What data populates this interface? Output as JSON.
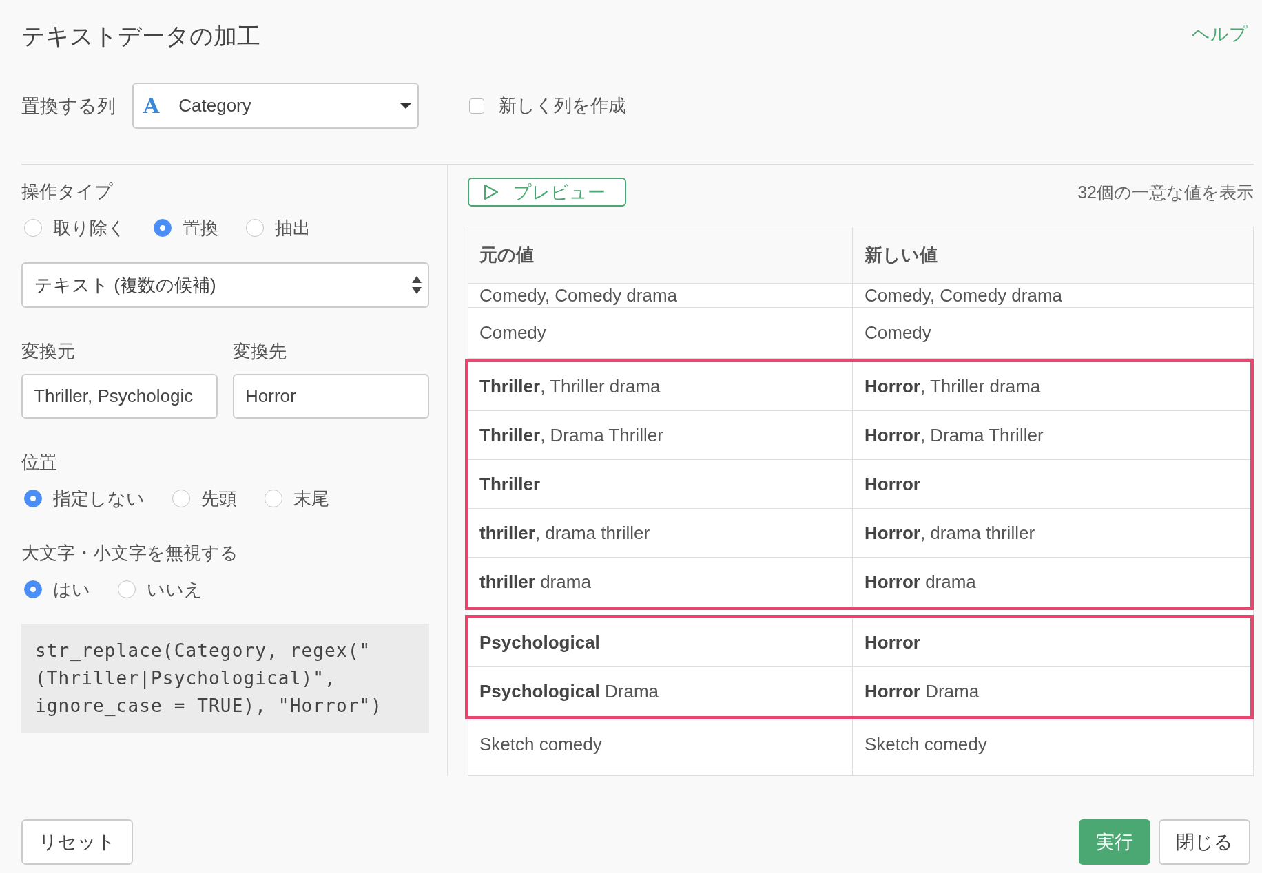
{
  "title": "テキストデータの加工",
  "help_link": "ヘルプ",
  "target_column": {
    "label": "置換する列",
    "type_glyph": "A",
    "value": "Category"
  },
  "new_column": {
    "label": "新しく列を作成",
    "checked": false
  },
  "operation_type": {
    "label": "操作タイプ",
    "options": [
      {
        "label": "取り除く",
        "selected": false
      },
      {
        "label": "置換",
        "selected": true
      },
      {
        "label": "抽出",
        "selected": false
      }
    ]
  },
  "match_mode": {
    "value": "テキスト (複数の候補)"
  },
  "replace_from": {
    "label": "変換元",
    "value": "Thriller, Psychologic"
  },
  "replace_to": {
    "label": "変換先",
    "value": "Horror"
  },
  "position": {
    "label": "位置",
    "options": [
      {
        "label": "指定しない",
        "selected": true
      },
      {
        "label": "先頭",
        "selected": false
      },
      {
        "label": "末尾",
        "selected": false
      }
    ]
  },
  "ignore_case": {
    "label": "大文字・小文字を無視する",
    "options": [
      {
        "label": "はい",
        "selected": true
      },
      {
        "label": "いいえ",
        "selected": false
      }
    ]
  },
  "code_lines": [
    "str_replace(Category, regex(\"",
    "(Thriller|Psychological)\",",
    "ignore_case = TRUE), \"Horror\")"
  ],
  "preview_button": "プレビュー",
  "unique_count": "32個の一意な値を表示",
  "table": {
    "columns": [
      "元の値",
      "新しい値"
    ],
    "row_groups": [
      {
        "highlighted": false,
        "rows": [
          {
            "cells": [
              "Comedy, Comedy drama",
              "Comedy, Comedy drama"
            ],
            "clipped": true
          },
          {
            "cells": [
              "Comedy",
              "Comedy"
            ],
            "clipped": false
          }
        ]
      },
      {
        "highlighted": true,
        "rows": [
          {
            "cells": [
              "**Thriller**, Thriller drama",
              "**Horror**, Thriller drama"
            ],
            "clipped": false
          },
          {
            "cells": [
              "**Thriller**, Drama Thriller",
              "**Horror**, Drama Thriller"
            ],
            "clipped": false
          },
          {
            "cells": [
              "**Thriller**",
              "**Horror**"
            ],
            "clipped": false
          },
          {
            "cells": [
              "**thriller**, drama thriller",
              "**Horror**, drama thriller"
            ],
            "clipped": false
          },
          {
            "cells": [
              "**thriller** drama",
              "**Horror** drama"
            ],
            "clipped": false
          }
        ]
      },
      {
        "highlighted": true,
        "rows": [
          {
            "cells": [
              "**Psychological**",
              "**Horror**"
            ],
            "clipped": false
          },
          {
            "cells": [
              "**Psychological** Drama",
              "**Horror** Drama"
            ],
            "clipped": false
          }
        ]
      },
      {
        "highlighted": false,
        "rows": [
          {
            "cells": [
              "Sketch comedy",
              "Sketch comedy"
            ],
            "clipped": false
          }
        ]
      }
    ]
  },
  "footer": {
    "left_buttons": [
      {
        "label": "リセット",
        "kind": "default"
      }
    ],
    "right_buttons": [
      {
        "label": "実行",
        "kind": "primary"
      },
      {
        "label": "閉じる",
        "kind": "default"
      }
    ]
  }
}
